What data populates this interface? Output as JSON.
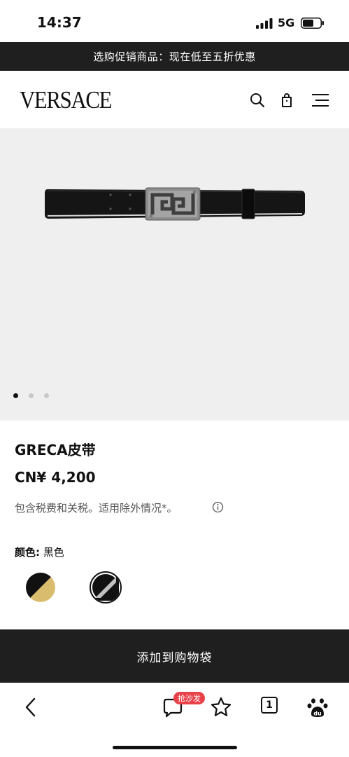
{
  "status_bar": {
    "time": "14:37",
    "network": "5G"
  },
  "promo": {
    "text": "选购促销商品：现在低至五折优惠"
  },
  "header": {
    "logo": "VERSACE",
    "icons": [
      "search-icon",
      "shopping-bag-icon",
      "menu-icon"
    ]
  },
  "gallery": {
    "image": "black-leather-belt-with-silver-greca-buckle",
    "dots": [
      {
        "active": true
      },
      {
        "active": false
      },
      {
        "active": false
      }
    ]
  },
  "product": {
    "title": "GRECA皮带",
    "price": "CN¥ 4,200",
    "tax_note": "包含税费和关税。适用除外情况*。",
    "color_label": "颜色:",
    "color_value": "黑色",
    "swatches": [
      {
        "name": "black-gold",
        "colors": [
          "#111111",
          "#d9bc6e"
        ]
      },
      {
        "name": "black-silver",
        "colors": [
          "#111111",
          "#c0c0c0"
        ],
        "selected": true
      }
    ]
  },
  "cta": {
    "label": "添加到购物袋"
  },
  "browser": {
    "comment_badge": "抢沙发",
    "tab_count": "1",
    "icons": [
      "back-arrow-icon",
      "comment-icon",
      "star-icon",
      "tabs-icon",
      "paw-icon"
    ]
  },
  "colors": {
    "banner_bg": "#1f1f1f",
    "gallery_bg": "#efefef",
    "badge_red": "#e8414a"
  }
}
